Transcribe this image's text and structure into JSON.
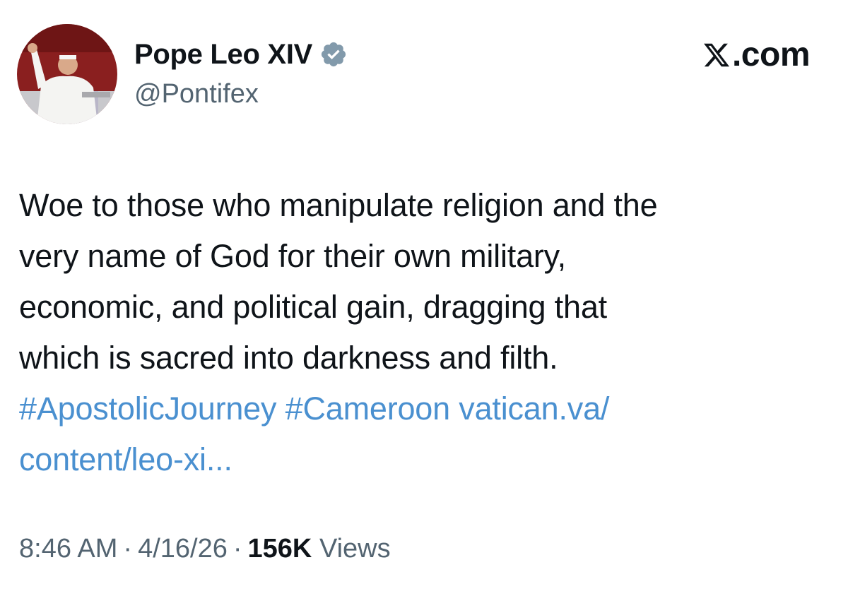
{
  "author": {
    "display_name": "Pope Leo XIV",
    "handle": "@Pontifex",
    "verified": true,
    "verified_color": "#829aab"
  },
  "source": {
    "label": ".com",
    "icon": "x-logo-icon"
  },
  "tweet": {
    "lines": [
      "Woe to those who manipulate religion and the",
      "very name of God for their own military,",
      "economic, and political gain, dragging that",
      "which is sacred into darkness and filth."
    ],
    "hashtag_1": "#ApostolicJourney",
    "hashtag_2": "#Cameroon",
    "link_part_1": "vatican.va/",
    "link_part_2": "content/leo-xi..."
  },
  "meta": {
    "time": "8:46 AM",
    "separator": "·",
    "date": "4/16/26",
    "views_count": "156K",
    "views_label": "Views"
  },
  "colors": {
    "link": "#4a90d0",
    "text": "#0f1419",
    "secondary": "#536471"
  }
}
